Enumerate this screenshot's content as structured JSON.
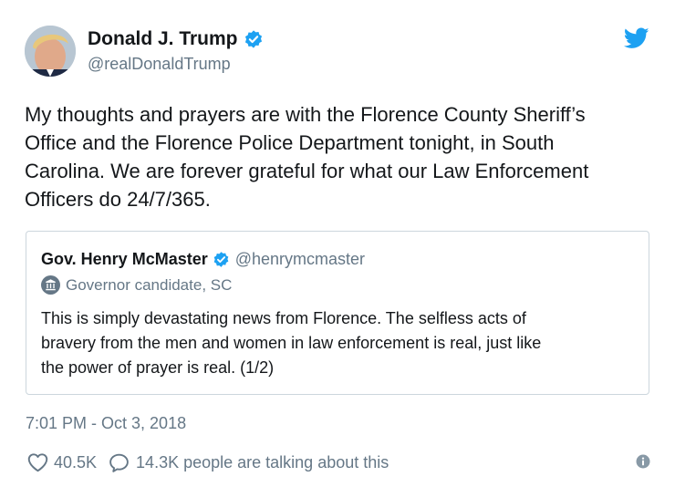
{
  "author": {
    "name": "Donald J. Trump",
    "handle": "@realDonaldTrump",
    "verified": true
  },
  "tweet": {
    "lines": [
      "My thoughts and prayers are with the Florence County Sheriff’s",
      "Office and the Florence Police Department tonight, in South",
      "Carolina. We are forever grateful for what our Law Enforcement",
      "Officers do 24/7/365."
    ]
  },
  "quoted_tweet": {
    "name": "Gov. Henry McMaster",
    "handle": "@henrymcmaster",
    "verified": true,
    "label": "Governor candidate, SC",
    "lines": [
      "This is simply devastating news from Florence. The selfless acts of",
      "bravery from the men and women in law enforcement is real, just like",
      "the power of prayer is real. (1/2)"
    ]
  },
  "timestamp": "7:01 PM - Oct 3, 2018",
  "stats": {
    "likes": "40.5K",
    "talking": "14.3K people are talking about this"
  },
  "colors": {
    "twitter_blue": "#1da1f2",
    "text": "#14171a",
    "secondary": "#657786",
    "border": "#ccd6dd"
  },
  "icons": [
    "avatar",
    "verified-badge-icon",
    "twitter-bird-icon",
    "government-building-icon",
    "heart-icon",
    "comment-bubble-icon",
    "info-icon"
  ]
}
